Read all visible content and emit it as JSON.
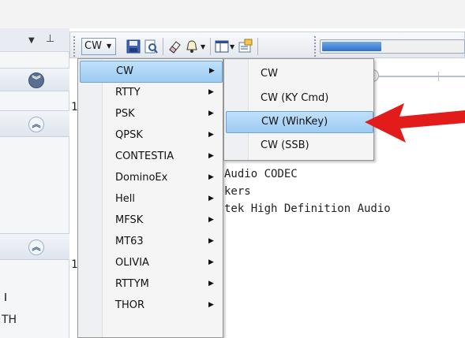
{
  "toolbar": {
    "mode_button_label": "CW",
    "progress_fraction": 0.42
  },
  "left_pane": {
    "partial_text": "TH"
  },
  "main_text": {
    "line1": "Audio CODEC",
    "line2": "kers",
    "line3": "tek High Definition Audio",
    "stray1": "1",
    "stray2": "1"
  },
  "modes_menu": {
    "items": [
      {
        "label": "CW",
        "highlighted": true
      },
      {
        "label": "RTTY"
      },
      {
        "label": "PSK"
      },
      {
        "label": "QPSK"
      },
      {
        "label": "CONTESTIA"
      },
      {
        "label": "DominoEx"
      },
      {
        "label": "Hell"
      },
      {
        "label": "MFSK"
      },
      {
        "label": "MT63"
      },
      {
        "label": "OLIVIA"
      },
      {
        "label": "RTTYM"
      },
      {
        "label": "THOR"
      }
    ]
  },
  "cw_submenu": {
    "items": [
      {
        "label": "CW"
      },
      {
        "label": "CW (KY Cmd)"
      },
      {
        "label": "CW (WinKey)",
        "highlighted": true
      },
      {
        "label": "CW (SSB)"
      }
    ]
  },
  "colors": {
    "arrow": "#e21b1b",
    "highlight": "#9ccbf3"
  }
}
